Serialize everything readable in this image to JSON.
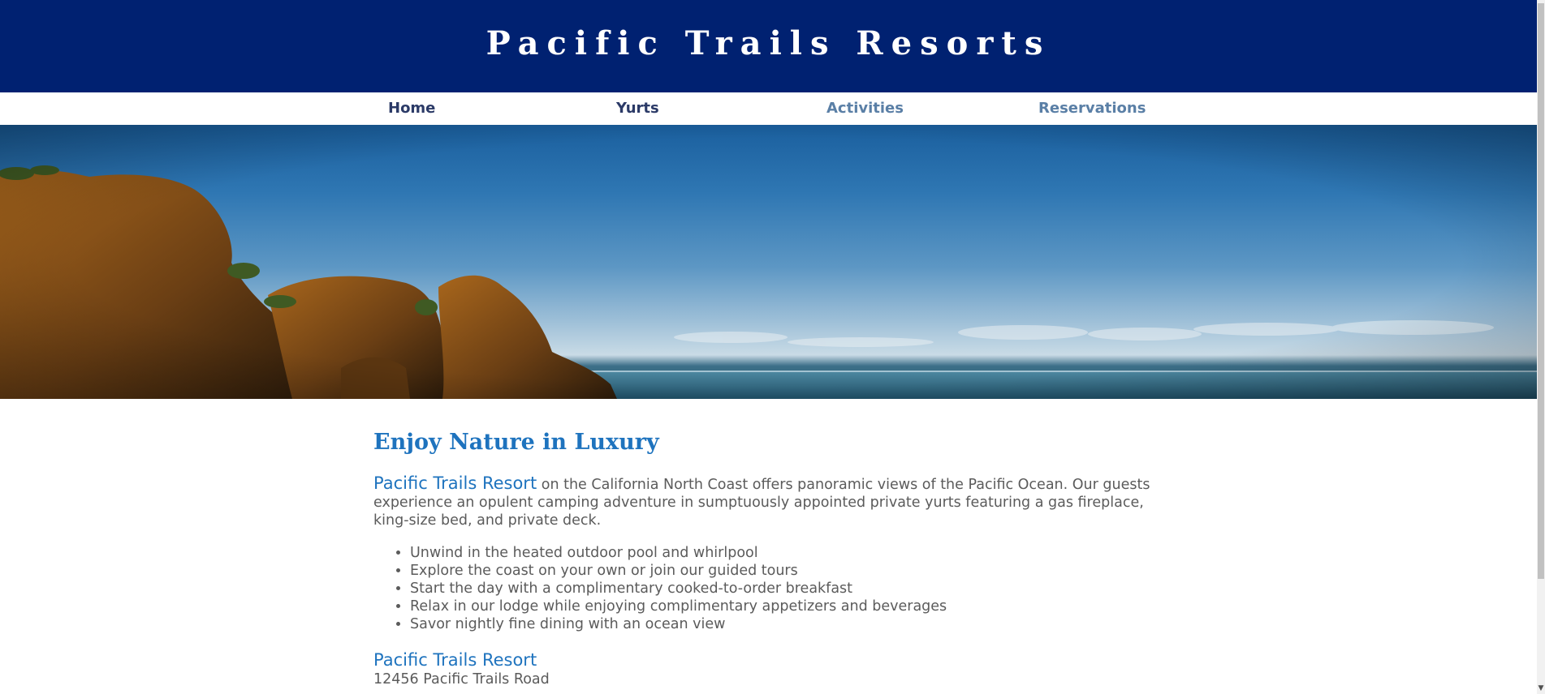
{
  "header": {
    "title": "Pacific Trails Resorts"
  },
  "nav": {
    "items": [
      {
        "label": "Home",
        "color": "#2b3a67"
      },
      {
        "label": "Yurts",
        "color": "#2b3a67"
      },
      {
        "label": "Activities",
        "color": "#5a7fa6"
      },
      {
        "label": "Reservations",
        "color": "#5a7fa6"
      }
    ]
  },
  "hero": {
    "icon": "ocean-coast-banner-image"
  },
  "main": {
    "heading": "Enjoy Nature in Luxury",
    "intro_brand": "Pacific Trails Resort",
    "intro_text": " on the California North Coast offers panoramic views of the Pacific Ocean. Our guests experience an opulent camping adventure in sumptuously appointed private yurts featuring a gas fireplace, king-size bed, and private deck.",
    "amenities": [
      "Unwind in the heated outdoor pool and whirlpool",
      "Explore the coast on your own or join our guided tours",
      "Start the day with a complimentary cooked-to-order breakfast",
      "Relax in our lodge while enjoying complimentary appetizers and beverages",
      "Savor nightly fine dining with an ocean view"
    ],
    "contact_name": "Pacific Trails Resort",
    "contact_address": "12456 Pacific Trails Road"
  },
  "colors": {
    "header_bg": "#002171",
    "accent": "#1e73be",
    "body_text": "#5b5b5b"
  }
}
